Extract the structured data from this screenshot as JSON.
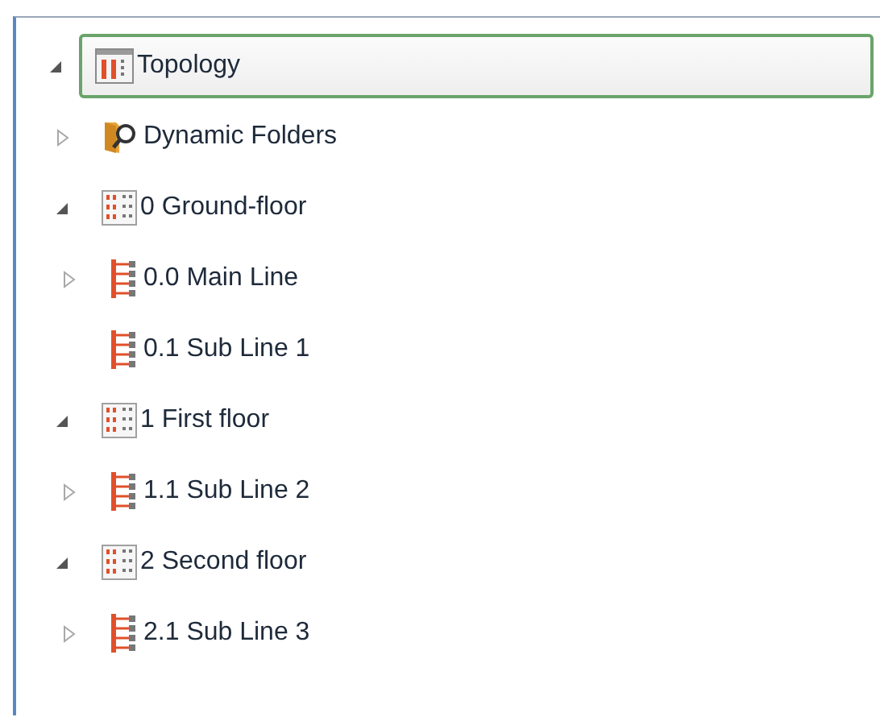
{
  "tree": [
    {
      "label": "Topology",
      "kind": "root",
      "selected": true,
      "expanded": true,
      "children": [
        {
          "label": "Dynamic Folders",
          "kind": "search-folder",
          "selected": false,
          "expanded": false
        },
        {
          "label": "0 Ground-floor",
          "kind": "floor",
          "selected": false,
          "expanded": true,
          "children": [
            {
              "label": "0.0 Main Line",
              "kind": "line",
              "selected": false,
              "expanded": false
            },
            {
              "label": "0.1 Sub Line 1",
              "kind": "line",
              "selected": false
            }
          ]
        },
        {
          "label": "1 First floor",
          "kind": "floor",
          "selected": false,
          "expanded": true,
          "children": [
            {
              "label": "1.1 Sub Line 2",
              "kind": "line",
              "selected": false,
              "expanded": false
            }
          ]
        },
        {
          "label": "2 Second floor",
          "kind": "floor",
          "selected": false,
          "expanded": true,
          "children": [
            {
              "label": "2.1 Sub Line 3",
              "kind": "line",
              "selected": false,
              "expanded": false
            }
          ]
        }
      ]
    }
  ]
}
